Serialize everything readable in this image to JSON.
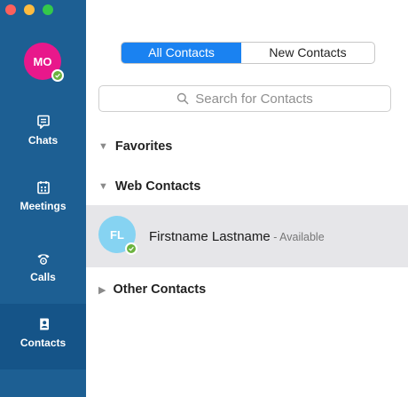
{
  "window": {
    "controls": [
      "close",
      "minimize",
      "maximize"
    ]
  },
  "user": {
    "initials": "MO",
    "avatar_color": "#e8188b",
    "presence_color": "#6cb33f"
  },
  "sidebar": {
    "background": "#1d5f93",
    "items": [
      {
        "label": "Chats",
        "icon": "chat-icon",
        "active": false
      },
      {
        "label": "Meetings",
        "icon": "calendar-icon",
        "active": false
      },
      {
        "label": "Calls",
        "icon": "phone-icon",
        "active": false
      },
      {
        "label": "Contacts",
        "icon": "contacts-icon",
        "active": true
      }
    ]
  },
  "tabs": [
    {
      "label": "All Contacts",
      "active": true
    },
    {
      "label": "New Contacts",
      "active": false
    }
  ],
  "search": {
    "placeholder": "Search for Contacts",
    "icon": "search-icon"
  },
  "sections": [
    {
      "label": "Favorites",
      "expanded": true
    },
    {
      "label": "Web Contacts",
      "expanded": true
    },
    {
      "label": "Other Contacts",
      "expanded": false
    }
  ],
  "contacts": [
    {
      "initials": "FL",
      "name": "Firstname Lastname",
      "status": " - Available",
      "avatar_color": "#86d3f2",
      "selected": true
    }
  ],
  "accent_color": "#1a82f1"
}
